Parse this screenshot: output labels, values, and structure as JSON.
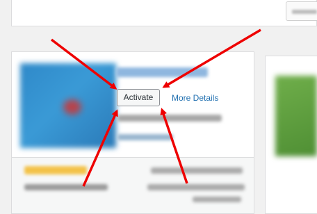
{
  "plugin_card": {
    "activate_label": "Activate",
    "more_details_label": "More Details"
  },
  "colors": {
    "annotation_arrow": "#ee0000",
    "link": "#2271b1",
    "thumbnail": "#2f89c9",
    "rating_stars": "#f3c248"
  },
  "annotation": {
    "arrow_count": 4
  }
}
